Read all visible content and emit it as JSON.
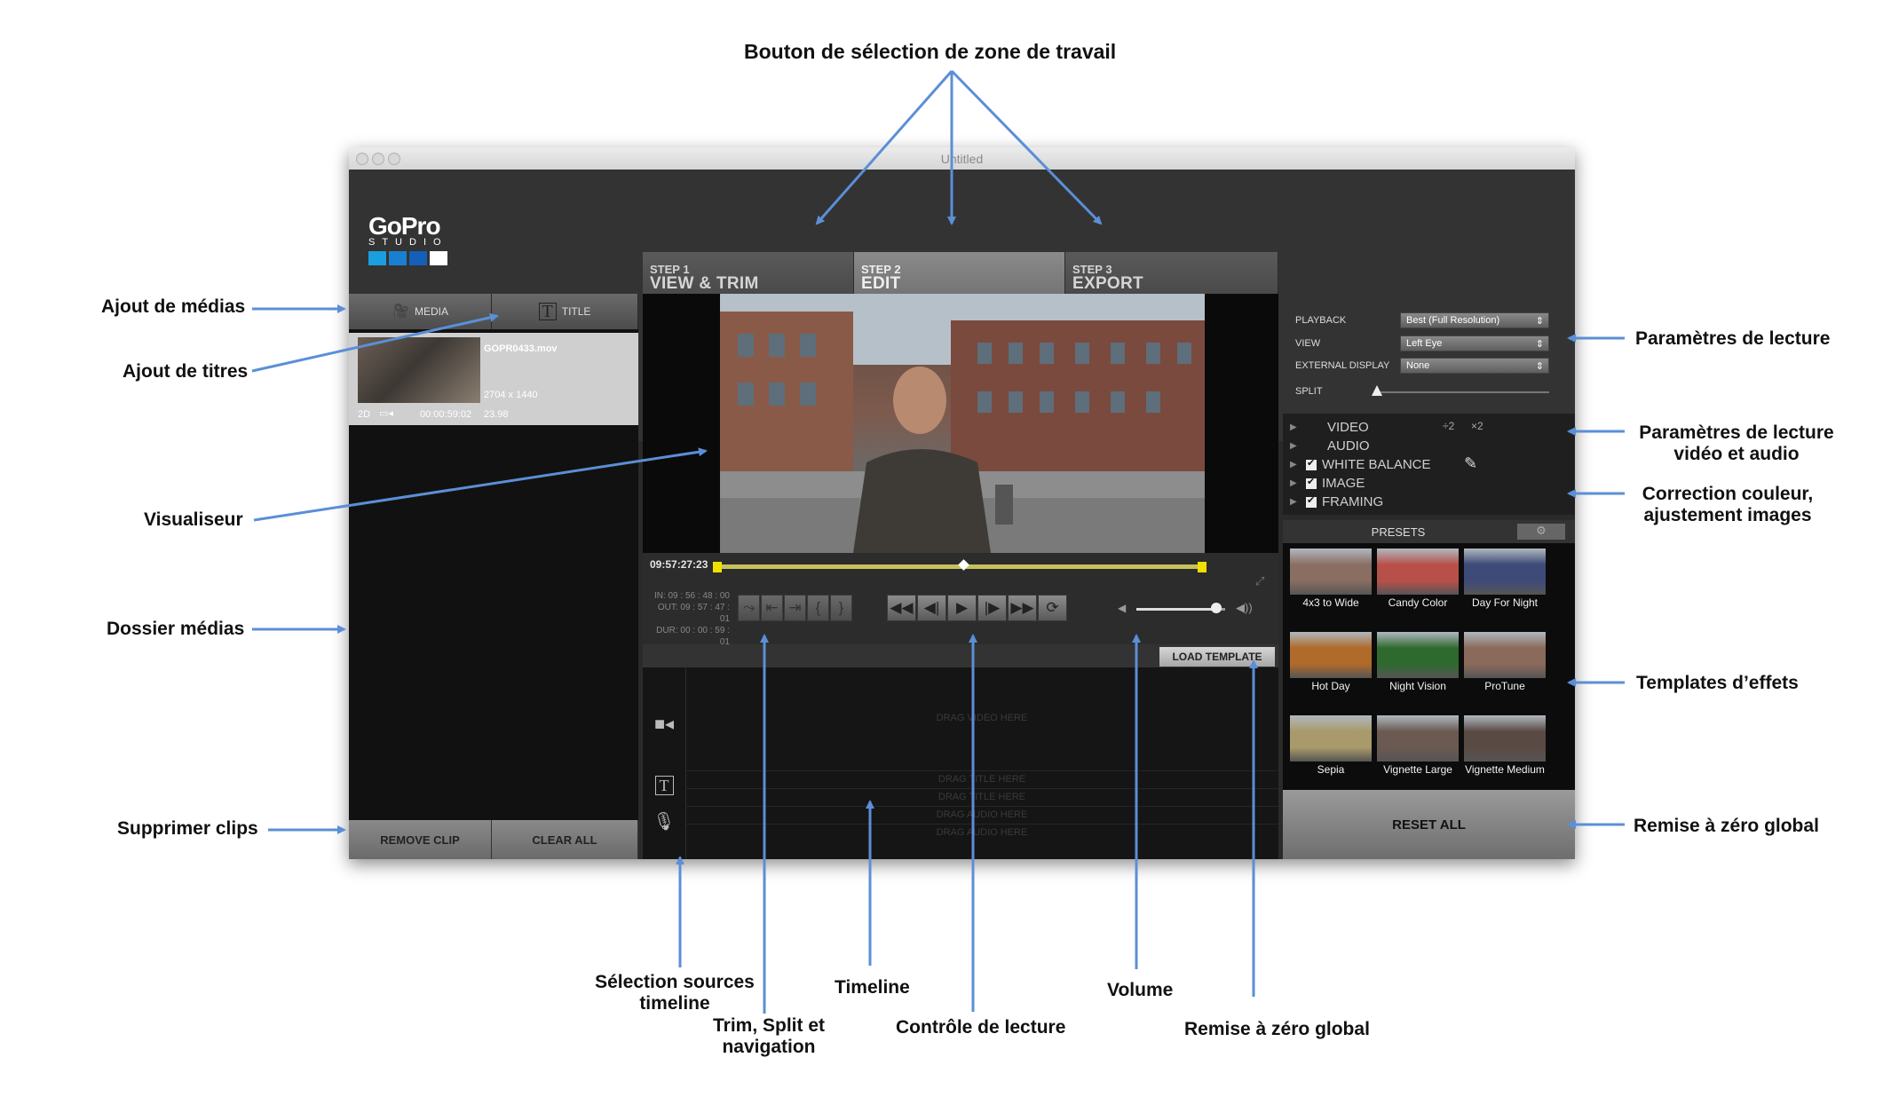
{
  "annotations": {
    "top": "Bouton de sélection de zone de travail",
    "ajout_medias": "Ajout de médias",
    "ajout_titres": "Ajout de titres",
    "visualiseur": "Visualiseur",
    "dossier_medias": "Dossier médias",
    "supprimer_clips": "Supprimer clips",
    "selection_sources_1": "Sélection sources",
    "selection_sources_2": "timeline",
    "trim_1": "Trim, Split et",
    "trim_2": "navigation",
    "timeline": "Timeline",
    "controle_lecture": "Contrôle de lecture",
    "volume": "Volume",
    "remise_zero_bottom": "Remise à zéro global",
    "parametres_lecture": "Paramètres de lecture",
    "param_video_audio_1": "Paramètres de lecture",
    "param_video_audio_2": "vidéo et audio",
    "correction_1": "Correction couleur,",
    "correction_2": "ajustement images",
    "templates_effets": "Templates d’effets",
    "remise_zero_right": "Remise à zéro global"
  },
  "window": {
    "title": "Untitled"
  },
  "logo": {
    "word": "GoPro",
    "sub": "STUDIO",
    "colors": [
      "#1a9ee0",
      "#1a7fd0",
      "#1460b8",
      "#ffffff"
    ]
  },
  "steps": [
    {
      "num": "STEP 1",
      "title": "VIEW & TRIM"
    },
    {
      "num": "STEP 2",
      "title": "EDIT"
    },
    {
      "num": "STEP 3",
      "title": "EXPORT"
    }
  ],
  "left_panel": {
    "media_tab": "MEDIA",
    "title_tab": "TITLE",
    "clip": {
      "name": "GOPR0433.mov",
      "resolution": "2704 x 1440",
      "mode": "2D",
      "duration": "00:00:59:02",
      "fps": "23.98"
    },
    "remove_clip": "REMOVE CLIP",
    "clear_all": "CLEAR ALL"
  },
  "player": {
    "timecode": "09:57:27:23",
    "in": "IN: 09 : 56 : 48 : 00",
    "out": "OUT: 09 : 57 : 47 : 01",
    "dur": "DUR: 00 : 00 : 59 : 01",
    "volume_level": 0.9
  },
  "timeline": {
    "load_template": "LOAD TEMPLATE",
    "drag_video": "DRAG VIDEO HERE",
    "drag_title_1": "DRAG TITLE HERE",
    "drag_title_2": "DRAG TITLE HERE",
    "drag_audio_1": "DRAG AUDIO HERE",
    "drag_audio_2": "DRAG AUDIO HERE"
  },
  "right_panel": {
    "playback_label": "PLAYBACK",
    "playback_value": "Best (Full Resolution)",
    "view_label": "VIEW",
    "view_value": "Left Eye",
    "external_label": "EXTERNAL DISPLAY",
    "external_value": "None",
    "split_label": "SPLIT",
    "speed_2": "÷2",
    "speed_x2": "×2",
    "props": [
      "VIDEO",
      "AUDIO",
      "WHITE BALANCE",
      "IMAGE",
      "FRAMING"
    ],
    "presets_label": "PRESETS",
    "presets": [
      "4x3 to Wide",
      "Candy Color",
      "Day For Night",
      "Hot Day",
      "Night Vision",
      "ProTune",
      "Sepia",
      "Vignette Large",
      "Vignette Medium"
    ],
    "reset_all": "RESET ALL"
  },
  "colors": {
    "arrow": "#5b8fd6",
    "scrub": "#c4c25a",
    "marker": "#f0e000"
  }
}
